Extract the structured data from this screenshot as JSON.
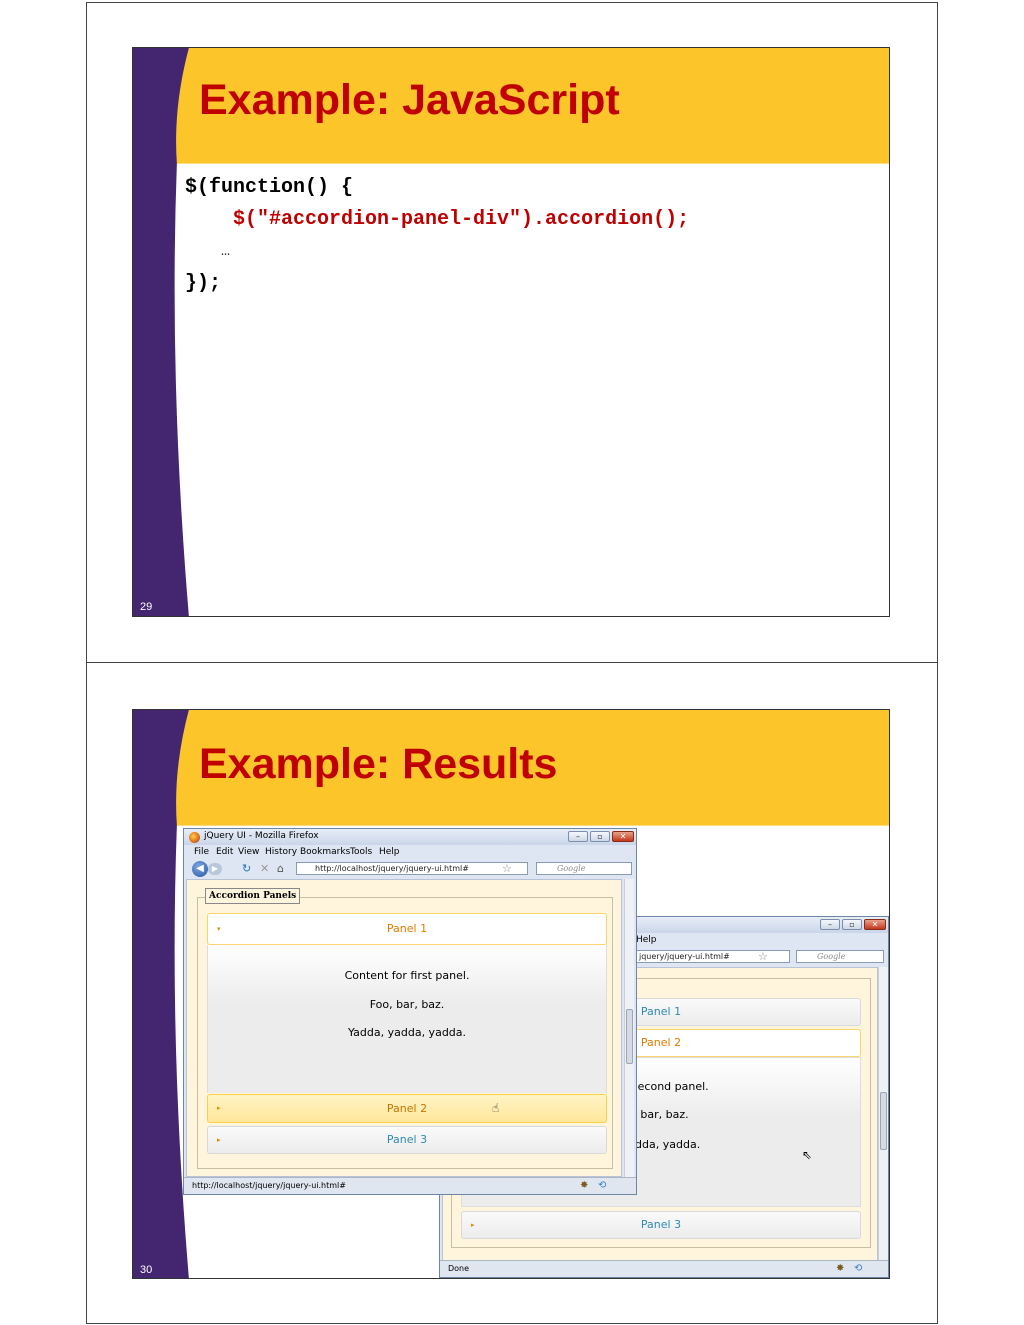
{
  "slides": [
    {
      "number": "29",
      "title": "Example: JavaScript",
      "code": [
        "$(function() {",
        "    $(\"#accordion-panel-div\").accordion();",
        "    …",
        "});"
      ]
    },
    {
      "number": "30",
      "title": "Example: Results",
      "front_window": {
        "title": "jQuery UI - Mozilla Firefox",
        "menu": [
          "File",
          "Edit",
          "View",
          "History",
          "Bookmarks",
          "Tools",
          "Help"
        ],
        "url": "http://localhost/jquery/jquery-ui.html#",
        "search_placeholder": "Google",
        "status": "http://localhost/jquery/jquery-ui.html#",
        "legend": "Accordion Panels",
        "panels": [
          "Panel 1",
          "Panel 2",
          "Panel 3"
        ],
        "panel1_content": [
          "Content for first panel.",
          "Foo, bar, baz.",
          "Yadda, yadda, yadda."
        ]
      },
      "back_window": {
        "menu_fragment": "Help",
        "url_fragment": "jquery/jquery-ui.html#",
        "search_placeholder": "Google",
        "status": "Done",
        "panels": [
          "Panel 1",
          "Panel 2",
          "Panel 3"
        ],
        "panel2_content": [
          "for second panel.",
          ", bar, baz.",
          "yadda, yadda."
        ]
      }
    }
  ],
  "colors": {
    "title_red": "#c00000",
    "band_gold": "#fcc52a",
    "sidebar_purple": "#432570"
  }
}
